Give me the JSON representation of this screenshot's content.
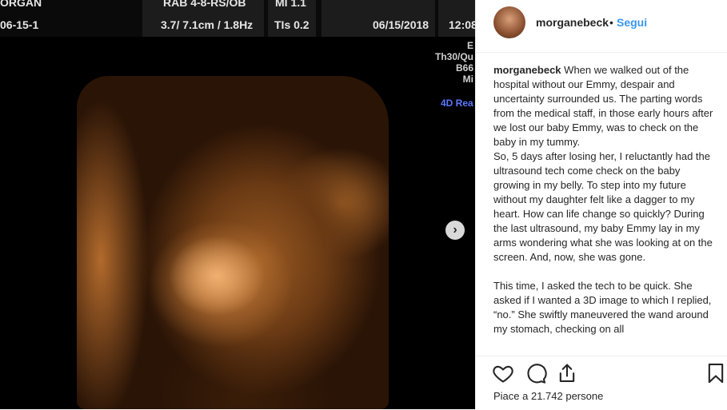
{
  "ultrasound": {
    "patient_name": "ORGAN",
    "probe": "RAB 4-8-RS/OB",
    "mi": "MI 1.1",
    "patient_id": "06-15-1",
    "params": "3.7/ 7.1cm / 1.8Hz",
    "tis": "TIs  0.2",
    "date": "06/15/2018",
    "time": "12:08",
    "side_lines": [
      "E",
      "Th30/Qu",
      "B66",
      "Mi"
    ],
    "mode": "4D Rea"
  },
  "post": {
    "username": "morganebeck",
    "dot": "•",
    "follow_label": "Segui",
    "caption_user": "morganebeck",
    "caption_p1": "When we walked out of the hospital without our Emmy, despair and uncertainty surrounded us. The parting words from the medical staff, in those early hours after we lost our baby Emmy, was to check on the baby in my tummy.",
    "caption_p2": "So, 5 days after losing her, I reluctantly had the ultrasound tech come check on the baby growing in my belly. To step into my future without my daughter felt like a dagger to my heart. How can life change so quickly? During the last ultrasound, my baby Emmy lay in my arms wondering what she was looking at on the screen. And, now, she was gone.",
    "caption_p3": "This time, I asked the tech to be quick. She asked if I wanted a 3D image to which I replied, “no.” She swiftly maneuvered the wand around my stomach, checking on all",
    "likes": "Piace a 21.742 persone"
  },
  "icons": {
    "like": "heart-icon",
    "comment": "comment-icon",
    "share": "share-icon",
    "save": "bookmark-icon",
    "next": "chevron-right-icon"
  },
  "colors": {
    "follow": "#3897f0",
    "mode_text": "#5a78ff",
    "text": "#262626"
  }
}
